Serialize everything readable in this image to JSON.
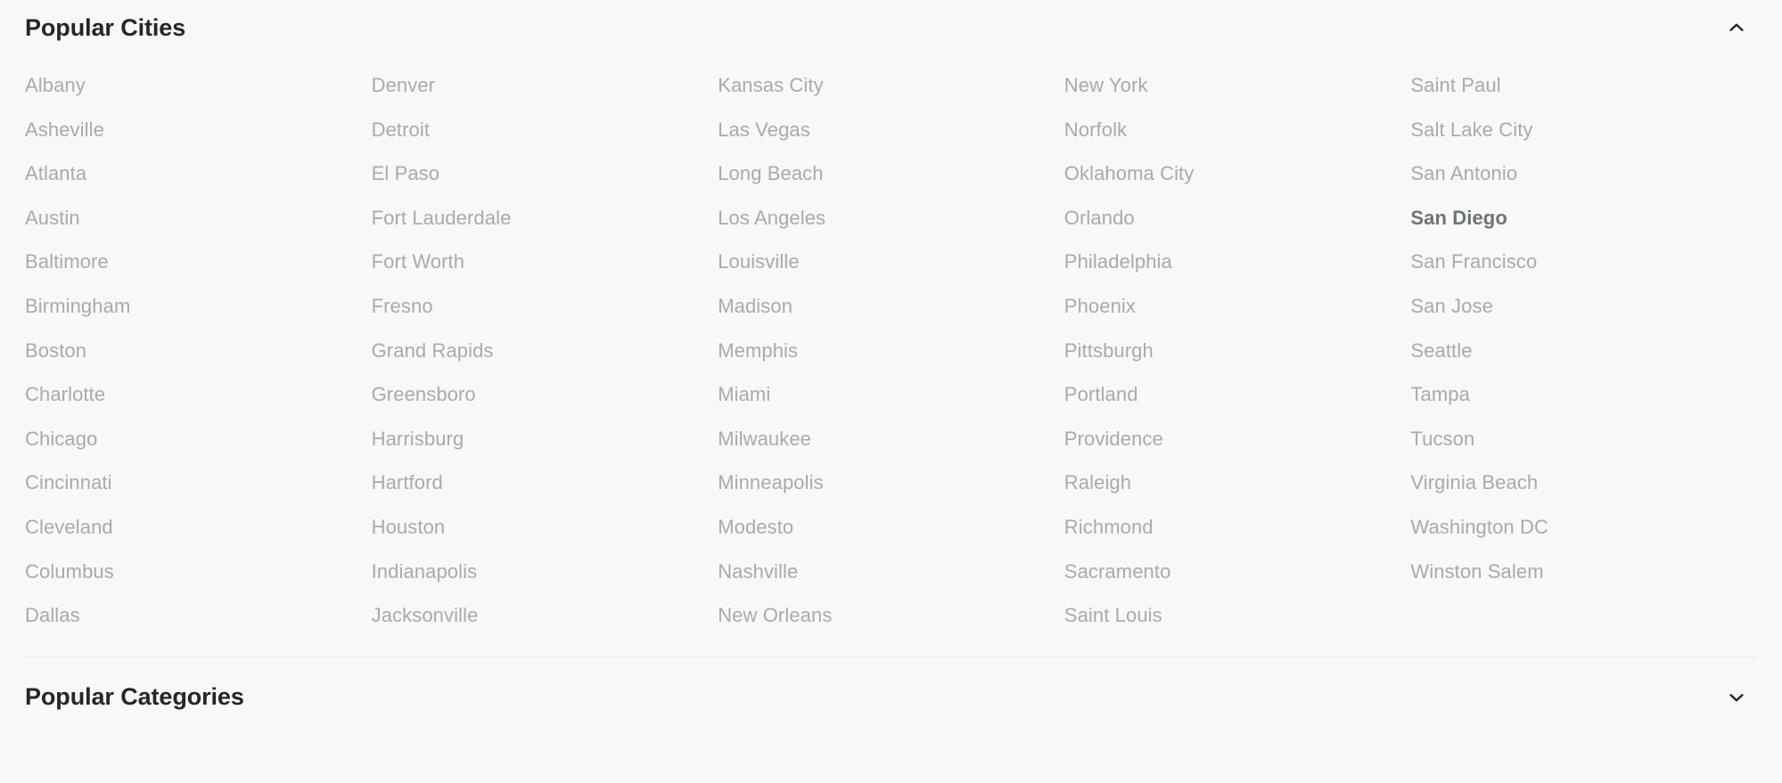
{
  "sections": [
    {
      "id": "popular-cities",
      "title": "Popular Cities",
      "expanded": true,
      "toggle_icon": "chevron-up-icon",
      "columns": [
        {
          "items": [
            {
              "label": "Albany",
              "selected": false
            },
            {
              "label": "Asheville",
              "selected": false
            },
            {
              "label": "Atlanta",
              "selected": false
            },
            {
              "label": "Austin",
              "selected": false
            },
            {
              "label": "Baltimore",
              "selected": false
            },
            {
              "label": "Birmingham",
              "selected": false
            },
            {
              "label": "Boston",
              "selected": false
            },
            {
              "label": "Charlotte",
              "selected": false
            },
            {
              "label": "Chicago",
              "selected": false
            },
            {
              "label": "Cincinnati",
              "selected": false
            },
            {
              "label": "Cleveland",
              "selected": false
            },
            {
              "label": "Columbus",
              "selected": false
            },
            {
              "label": "Dallas",
              "selected": false
            }
          ]
        },
        {
          "items": [
            {
              "label": "Denver",
              "selected": false
            },
            {
              "label": "Detroit",
              "selected": false
            },
            {
              "label": "El Paso",
              "selected": false
            },
            {
              "label": "Fort Lauderdale",
              "selected": false
            },
            {
              "label": "Fort Worth",
              "selected": false
            },
            {
              "label": "Fresno",
              "selected": false
            },
            {
              "label": "Grand Rapids",
              "selected": false
            },
            {
              "label": "Greensboro",
              "selected": false
            },
            {
              "label": "Harrisburg",
              "selected": false
            },
            {
              "label": "Hartford",
              "selected": false
            },
            {
              "label": "Houston",
              "selected": false
            },
            {
              "label": "Indianapolis",
              "selected": false
            },
            {
              "label": "Jacksonville",
              "selected": false
            }
          ]
        },
        {
          "items": [
            {
              "label": "Kansas City",
              "selected": false
            },
            {
              "label": "Las Vegas",
              "selected": false
            },
            {
              "label": "Long Beach",
              "selected": false
            },
            {
              "label": "Los Angeles",
              "selected": false
            },
            {
              "label": "Louisville",
              "selected": false
            },
            {
              "label": "Madison",
              "selected": false
            },
            {
              "label": "Memphis",
              "selected": false
            },
            {
              "label": "Miami",
              "selected": false
            },
            {
              "label": "Milwaukee",
              "selected": false
            },
            {
              "label": "Minneapolis",
              "selected": false
            },
            {
              "label": "Modesto",
              "selected": false
            },
            {
              "label": "Nashville",
              "selected": false
            },
            {
              "label": "New Orleans",
              "selected": false
            }
          ]
        },
        {
          "items": [
            {
              "label": "New York",
              "selected": false
            },
            {
              "label": "Norfolk",
              "selected": false
            },
            {
              "label": "Oklahoma City",
              "selected": false
            },
            {
              "label": "Orlando",
              "selected": false
            },
            {
              "label": "Philadelphia",
              "selected": false
            },
            {
              "label": "Phoenix",
              "selected": false
            },
            {
              "label": "Pittsburgh",
              "selected": false
            },
            {
              "label": "Portland",
              "selected": false
            },
            {
              "label": "Providence",
              "selected": false
            },
            {
              "label": "Raleigh",
              "selected": false
            },
            {
              "label": "Richmond",
              "selected": false
            },
            {
              "label": "Sacramento",
              "selected": false
            },
            {
              "label": "Saint Louis",
              "selected": false
            }
          ]
        },
        {
          "items": [
            {
              "label": "Saint Paul",
              "selected": false
            },
            {
              "label": "Salt Lake City",
              "selected": false
            },
            {
              "label": "San Antonio",
              "selected": false
            },
            {
              "label": "San Diego",
              "selected": true
            },
            {
              "label": "San Francisco",
              "selected": false
            },
            {
              "label": "San Jose",
              "selected": false
            },
            {
              "label": "Seattle",
              "selected": false
            },
            {
              "label": "Tampa",
              "selected": false
            },
            {
              "label": "Tucson",
              "selected": false
            },
            {
              "label": "Virginia Beach",
              "selected": false
            },
            {
              "label": "Washington DC",
              "selected": false
            },
            {
              "label": "Winston Salem",
              "selected": false
            }
          ]
        }
      ]
    },
    {
      "id": "popular-categories",
      "title": "Popular Categories",
      "expanded": false,
      "toggle_icon": "chevron-down-icon",
      "columns": []
    }
  ],
  "colors": {
    "background": "#f7f8f8",
    "heading_text": "#24272a",
    "item_text": "#a7abad",
    "item_text_selected": "#6e7376",
    "divider": "#e7e9e9",
    "icon": "#24272a"
  }
}
